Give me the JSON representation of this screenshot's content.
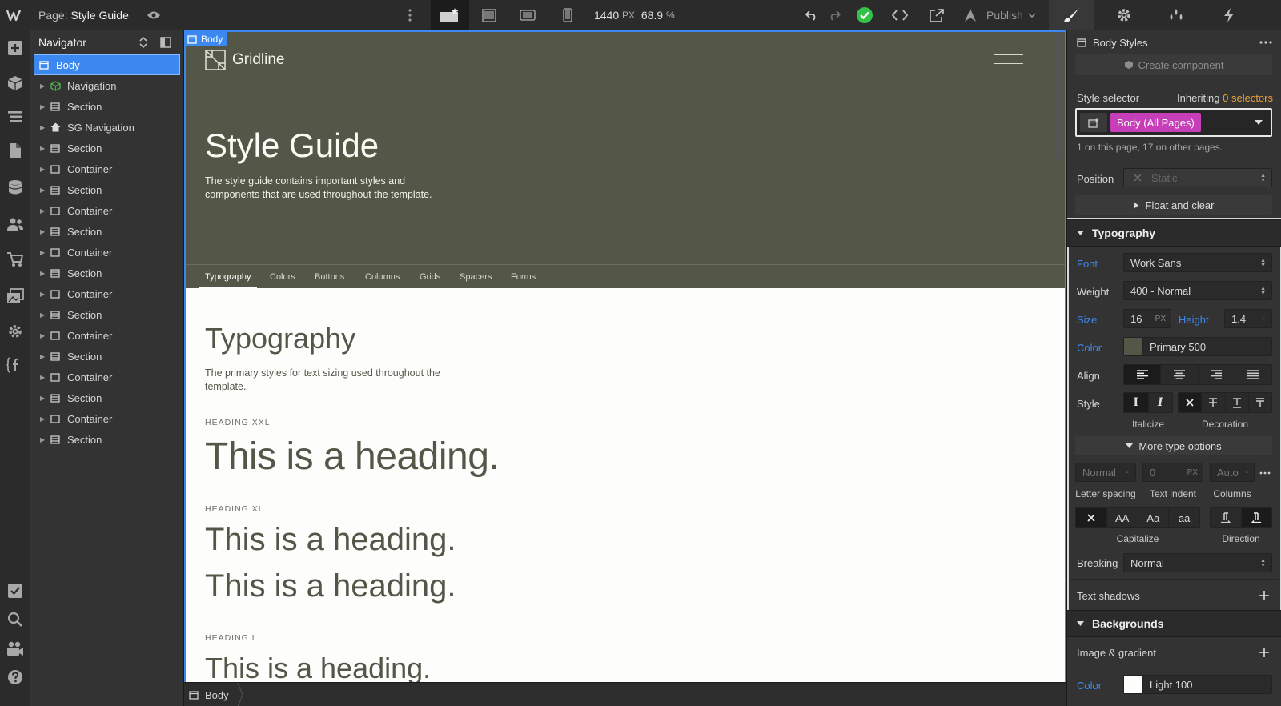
{
  "topbar": {
    "page_prefix": "Page:",
    "page_name": "Style Guide",
    "width_value": "1440",
    "width_unit": "PX",
    "zoom": "68.9",
    "zoom_unit": "%",
    "publish_label": "Publish"
  },
  "navigator": {
    "title": "Navigator",
    "items": [
      {
        "label": "Body",
        "icon": "body-icon"
      },
      {
        "label": "Navigation",
        "icon": "component-icon"
      },
      {
        "label": "Section",
        "icon": "section-icon"
      },
      {
        "label": "SG Navigation",
        "icon": "home-icon"
      },
      {
        "label": "Section",
        "icon": "section-icon"
      },
      {
        "label": "Container",
        "icon": "container-icon"
      },
      {
        "label": "Section",
        "icon": "section-icon"
      },
      {
        "label": "Container",
        "icon": "container-icon"
      },
      {
        "label": "Section",
        "icon": "section-icon"
      },
      {
        "label": "Container",
        "icon": "container-icon"
      },
      {
        "label": "Section",
        "icon": "section-icon"
      },
      {
        "label": "Container",
        "icon": "container-icon"
      },
      {
        "label": "Section",
        "icon": "section-icon"
      },
      {
        "label": "Container",
        "icon": "container-icon"
      },
      {
        "label": "Section",
        "icon": "section-icon"
      },
      {
        "label": "Container",
        "icon": "container-icon"
      },
      {
        "label": "Section",
        "icon": "section-icon"
      },
      {
        "label": "Container",
        "icon": "container-icon"
      },
      {
        "label": "Section",
        "icon": "section-icon"
      }
    ]
  },
  "canvas": {
    "selected_label": "Body",
    "brand": "Gridline",
    "hero_title": "Style Guide",
    "hero_desc_1": "The style guide contains important styles and",
    "hero_desc_2": "components that are used throughout the template.",
    "tabs": [
      "Typography",
      "Colors",
      "Buttons",
      "Columns",
      "Grids",
      "Spacers",
      "Forms"
    ],
    "section_title": "Typography",
    "section_desc_1": "The primary styles for text sizing used throughout the",
    "section_desc_2": "template.",
    "labels": {
      "xxl": "HEADING XXL",
      "xl": "HEADING XL",
      "l": "HEADING L"
    },
    "sample_heading": "This is a heading."
  },
  "breadcrumb": {
    "item": "Body"
  },
  "panel": {
    "title": "Body Styles",
    "create_component": "Create component",
    "style_selector_label": "Style selector",
    "inheriting_prefix": "Inheriting",
    "inheriting_link": "0 selectors",
    "selector_tag": "Body (All Pages)",
    "selector_info": "1 on this page, 17 on other pages.",
    "position_label": "Position",
    "position_value": "Static",
    "float_clear": "Float and clear",
    "typography": {
      "header": "Typography",
      "font_label": "Font",
      "font_value": "Work Sans",
      "weight_label": "Weight",
      "weight_value": "400 - Normal",
      "size_label": "Size",
      "size_value": "16",
      "size_unit": "PX",
      "height_label": "Height",
      "height_value": "1.4",
      "height_unit": "-",
      "color_label": "Color",
      "color_value": "Primary 500",
      "align_label": "Align",
      "style_label": "Style",
      "italicize": "Italicize",
      "decoration": "Decoration",
      "more_type": "More type options",
      "letter_spacing_value": "Normal",
      "letter_spacing_unit": "-",
      "text_indent_value": "0",
      "text_indent_unit": "PX",
      "columns_value": "Auto",
      "columns_unit": "-",
      "letter_spacing_label": "Letter spacing",
      "text_indent_label": "Text indent",
      "columns_label": "Columns",
      "cap_aa": "AA",
      "cap_title": "Aa",
      "cap_lower": "aa",
      "capitalize_label": "Capitalize",
      "direction_label": "Direction",
      "breaking_label": "Breaking",
      "breaking_value": "Normal",
      "text_shadows": "Text shadows"
    },
    "backgrounds": {
      "header": "Backgrounds",
      "image_gradient": "Image & gradient",
      "color_label": "Color",
      "color_value": "Light 100"
    }
  },
  "colors": {
    "accent": "#3b89f0",
    "selector_tag": "#c73fb8",
    "hero_bg": "#545648",
    "primary_500": "#545648",
    "light_100": "#fdfdfb",
    "success": "#35c24a",
    "inherit_link": "#e9a23b"
  }
}
